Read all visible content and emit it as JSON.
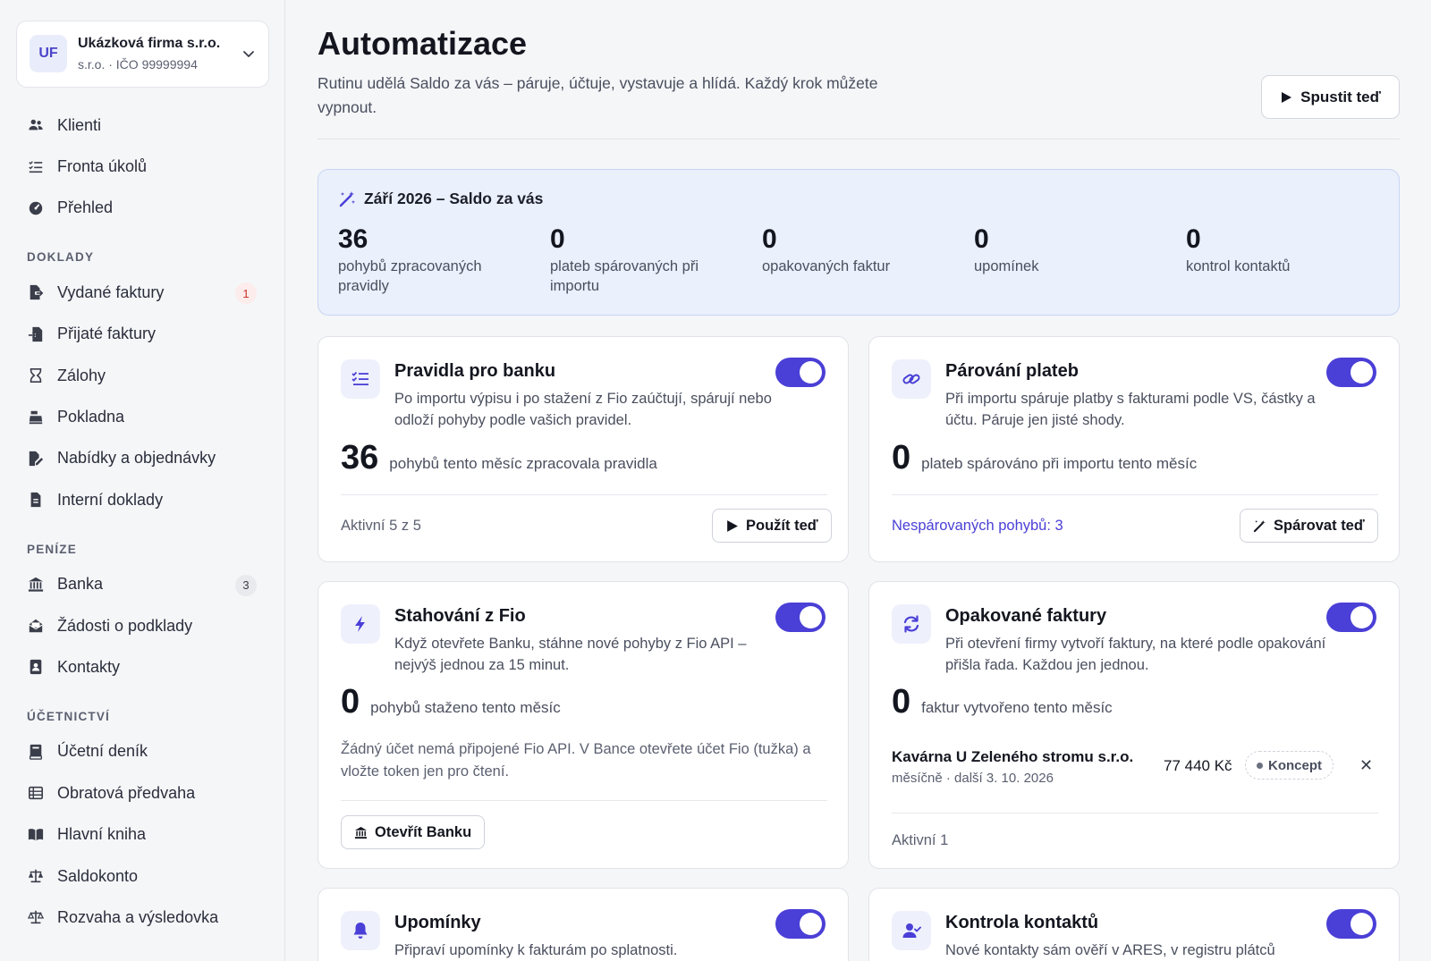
{
  "company": {
    "initials": "UF",
    "name": "Ukázková firma s.r.o.",
    "sub": "s.r.o. · IČO 99999994"
  },
  "nav": {
    "top": [
      {
        "label": "Klienti",
        "icon": "users-icon"
      },
      {
        "label": "Fronta úkolů",
        "icon": "list-check-icon"
      },
      {
        "label": "Přehled",
        "icon": "gauge-icon"
      }
    ],
    "sections": [
      {
        "title": "DOKLADY",
        "items": [
          {
            "label": "Vydané faktury",
            "icon": "file-export-icon",
            "badge": "1"
          },
          {
            "label": "Přijaté faktury",
            "icon": "file-import-icon"
          },
          {
            "label": "Zálohy",
            "icon": "hourglass-icon"
          },
          {
            "label": "Pokladna",
            "icon": "cash-register-icon"
          },
          {
            "label": "Nabídky a objednávky",
            "icon": "file-signature-icon"
          },
          {
            "label": "Interní doklady",
            "icon": "file-icon"
          }
        ]
      },
      {
        "title": "PENÍZE",
        "items": [
          {
            "label": "Banka",
            "icon": "bank-icon",
            "badge": "3"
          },
          {
            "label": "Žádosti o podklady",
            "icon": "envelope-open-icon"
          },
          {
            "label": "Kontakty",
            "icon": "address-book-icon"
          }
        ]
      },
      {
        "title": "ÚČETNICTVÍ",
        "items": [
          {
            "label": "Účetní deník",
            "icon": "book-icon"
          },
          {
            "label": "Obratová předvaha",
            "icon": "table-icon"
          },
          {
            "label": "Hlavní kniha",
            "icon": "book-open-icon"
          },
          {
            "label": "Saldokonto",
            "icon": "scale-icon"
          },
          {
            "label": "Rozvaha a výsledovka",
            "icon": "scale-balanced-icon"
          }
        ]
      }
    ]
  },
  "page": {
    "title": "Automatizace",
    "description": "Rutinu udělá Saldo za vás – páruje, účtuje, vystavuje a hlídá. Každý krok můžete vypnout.",
    "run_label": "Spustit teď"
  },
  "summary": {
    "heading": "Září 2026 – Saldo za vás",
    "stats": [
      {
        "value": "36",
        "label": "pohybů zpracovaných pravidly"
      },
      {
        "value": "0",
        "label": "plateb spárovaných při importu"
      },
      {
        "value": "0",
        "label": "opakovaných faktur"
      },
      {
        "value": "0",
        "label": "upomínek"
      },
      {
        "value": "0",
        "label": "kontrol kontaktů"
      }
    ]
  },
  "cards": {
    "rules": {
      "title": "Pravidla pro banku",
      "desc": "Po importu výpisu i po stažení z Fio zaúčtují, spárují nebo odloží pohyby podle vašich pravidel.",
      "value": "36",
      "value_label": "pohybů tento měsíc zpracovala pravidla",
      "footer": "Aktivní 5 z 5",
      "button": "Použít teď",
      "enabled": true
    },
    "matching": {
      "title": "Párování plateb",
      "desc": "Při importu spáruje platby s fakturami podle VS, částky a účtu. Páruje jen jisté shody.",
      "value": "0",
      "value_label": "plateb spárováno při importu tento měsíc",
      "footer": "Nespárovaných pohybů: 3",
      "button": "Spárovat teď",
      "enabled": true
    },
    "fio": {
      "title": "Stahování z Fio",
      "desc": "Když otevřete Banku, stáhne nové pohyby z Fio API – nejvýš jednou za 15 minut.",
      "value": "0",
      "value_label": "pohybů staženo tento měsíc",
      "note": "Žádný účet nemá připojené Fio API. V Bance otevřete účet Fio (tužka) a vložte token jen pro čtení.",
      "button": "Otevřít Banku",
      "enabled": true
    },
    "recurring": {
      "title": "Opakované faktury",
      "desc": "Při otevření firmy vytvoří faktury, na které podle opakování přišla řada. Každou jen jednou.",
      "value": "0",
      "value_label": "faktur vytvořeno tento měsíc",
      "invoice": {
        "name": "Kavárna U Zeleného stromu s.r.o.",
        "meta": "měsíčně · další 3. 10. 2026",
        "amount": "77 440 Kč",
        "status": "Koncept"
      },
      "footer": "Aktivní 1",
      "enabled": true
    },
    "reminders": {
      "title": "Upomínky",
      "desc": "Připraví upomínky k fakturám po splatnosti.",
      "enabled": true
    },
    "contacts": {
      "title": "Kontrola kontaktů",
      "desc": "Nové kontakty sám ověří v ARES, v registru plátců",
      "enabled": true
    }
  },
  "colors": {
    "accent": "#4a3fd6",
    "summary_bg": "#eaf0fc",
    "badge_red": "#c8352b"
  }
}
